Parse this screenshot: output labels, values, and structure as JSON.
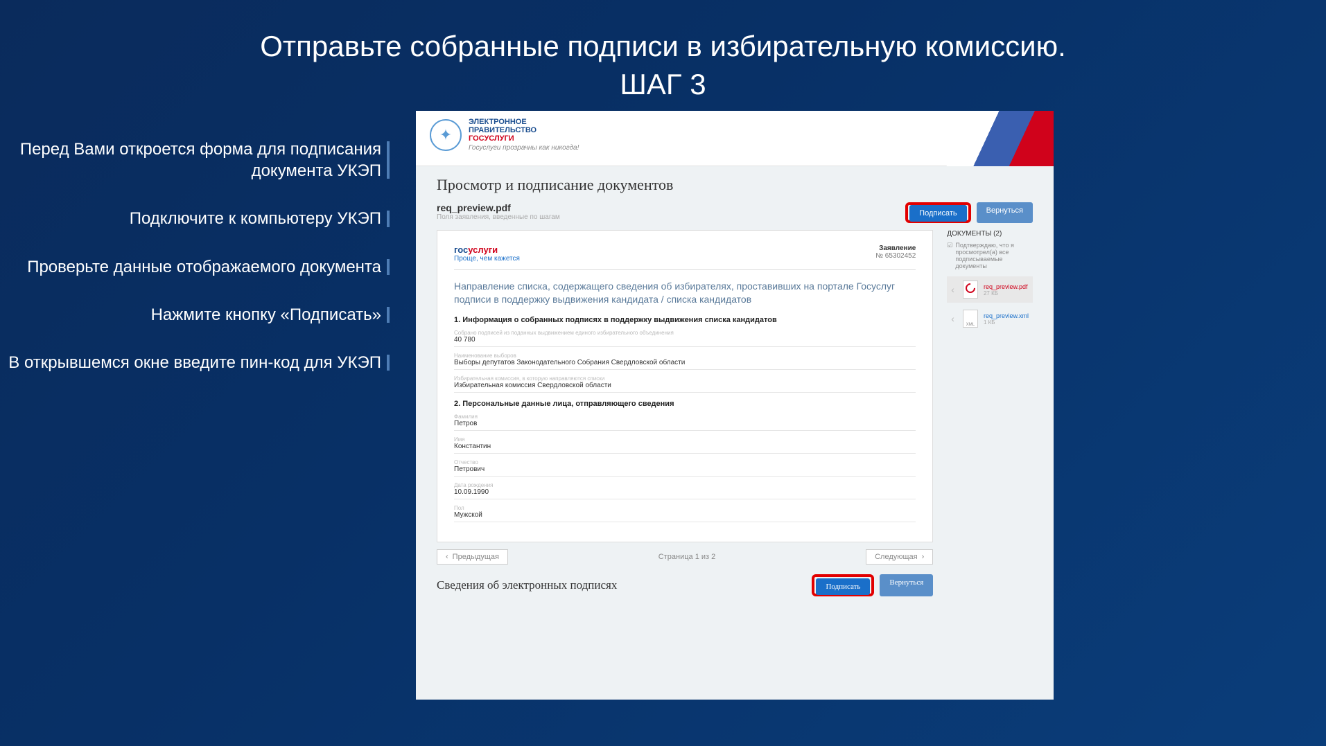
{
  "slide": {
    "title_line1": "Отправьте собранные подписи в избирательную комиссию.",
    "title_line2": "ШАГ 3"
  },
  "steps": [
    "Перед Вами откроется форма для подписания документа УКЭП",
    "Подключите к компьютеру УКЭП",
    "Проверьте данные отображаемого документа",
    "Нажмите кнопку «Подписать»",
    "В открывшемся окне введите пин-код для УКЭП"
  ],
  "gov_header": {
    "line1": "ЭЛЕКТРОННОЕ",
    "line2": "ПРАВИТЕЛЬСТВО",
    "line3": "ГОСУСЛУГИ",
    "sub": "Госуслуги прозрачны как никогда!"
  },
  "section_title": "Просмотр и подписание документов",
  "doc": {
    "name": "req_preview.pdf",
    "sub": "Поля заявления, введенные по шагам"
  },
  "buttons": {
    "sign": "Подписать",
    "back": "Вернуться"
  },
  "preview": {
    "gu_text": "госуслуги",
    "gu_sub": "Проще, чем кажется",
    "zayavlenie": "Заявление",
    "zayav_no": "№ 65302452",
    "intro": "Направление списка, содержащего сведения об избирателях, проставивших на портале Госуслуг подписи в поддержку выдвижения кандидата / списка кандидатов",
    "sec1_title": "1. Информация о собранных подписях в поддержку выдвижения списка кандидатов",
    "fields1": [
      {
        "label": "Собрано подписей из поданных выдвижением единого избирательного объединения",
        "value": "40 780"
      },
      {
        "label": "Наименование выборов",
        "value": "Выборы депутатов Законодательного Собрания Свердловской области"
      },
      {
        "label": "Избирательная комиссия, в которую направляются списки",
        "value": "Избирательная комиссия Свердловской области"
      }
    ],
    "sec2_title": "2. Персональные данные лица, отправляющего сведения",
    "fields2": [
      {
        "label": "Фамилия",
        "value": "Петров"
      },
      {
        "label": "Имя",
        "value": "Константин"
      },
      {
        "label": "Отчество",
        "value": "Петрович"
      },
      {
        "label": "Дата рождения",
        "value": "10.09.1990"
      },
      {
        "label": "Пол",
        "value": "Мужской"
      }
    ]
  },
  "pager": {
    "prev": "Предыдущая",
    "info": "Страница 1 из 2",
    "next": "Следующая"
  },
  "sig_title": "Сведения об электронных подписях",
  "sidebar": {
    "title": "ДОКУМЕНТЫ (2)",
    "confirm": "Подтверждаю, что я просмотрел(а) все подписываемые документы",
    "files": [
      {
        "name": "req_preview.pdf",
        "size": "27 КБ",
        "type": "pdf",
        "active": true
      },
      {
        "name": "req_preview.xml",
        "size": "1 КБ",
        "type": "xml",
        "active": false
      }
    ]
  }
}
